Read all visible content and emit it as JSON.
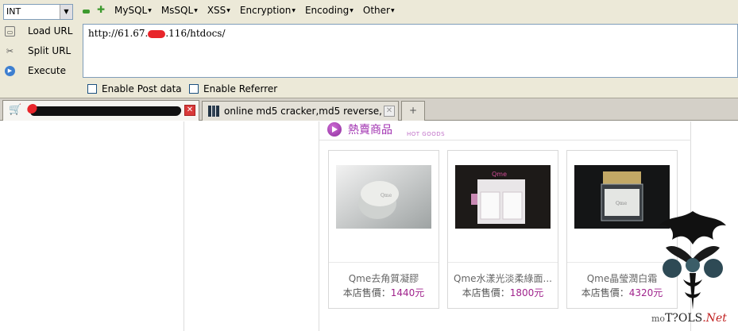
{
  "hackbar": {
    "type_select": "INT",
    "menu": [
      "MySQL",
      "MsSQL",
      "XSS",
      "Encryption",
      "Encoding",
      "Other"
    ],
    "side_buttons": [
      "Load URL",
      "Split URL",
      "Execute"
    ],
    "url_prefix": "http://61.67.",
    "url_suffix": ".116/htdocs/",
    "checkboxes": [
      "Enable Post data",
      "Enable Referrer"
    ]
  },
  "tabs": [
    {
      "label": "",
      "active": true
    },
    {
      "label": "online md5 cracker,md5 reverse, ...",
      "active": false
    }
  ],
  "new_tab_symbol": "+",
  "shop": {
    "section_title": "熱賣商品",
    "section_subtitle": "HOT GOODS",
    "products": [
      {
        "name": "Qme去角質凝膠",
        "price_label": "本店售價：",
        "price": "1440元"
      },
      {
        "name": "Qme水漾光淡柔綠面...",
        "price_label": "本店售價：",
        "price": "1800元"
      },
      {
        "name": "Qme晶瑩潤白霜",
        "price_label": "本店售價：",
        "price": "4320元"
      }
    ]
  },
  "watermark": {
    "prefix": "mo",
    "brand": "T?OLS",
    "suffix": ".Net"
  },
  "colors": {
    "accent": "#a02fb0",
    "price": "#a0238c",
    "hackbar_bg": "#ece9d8"
  }
}
